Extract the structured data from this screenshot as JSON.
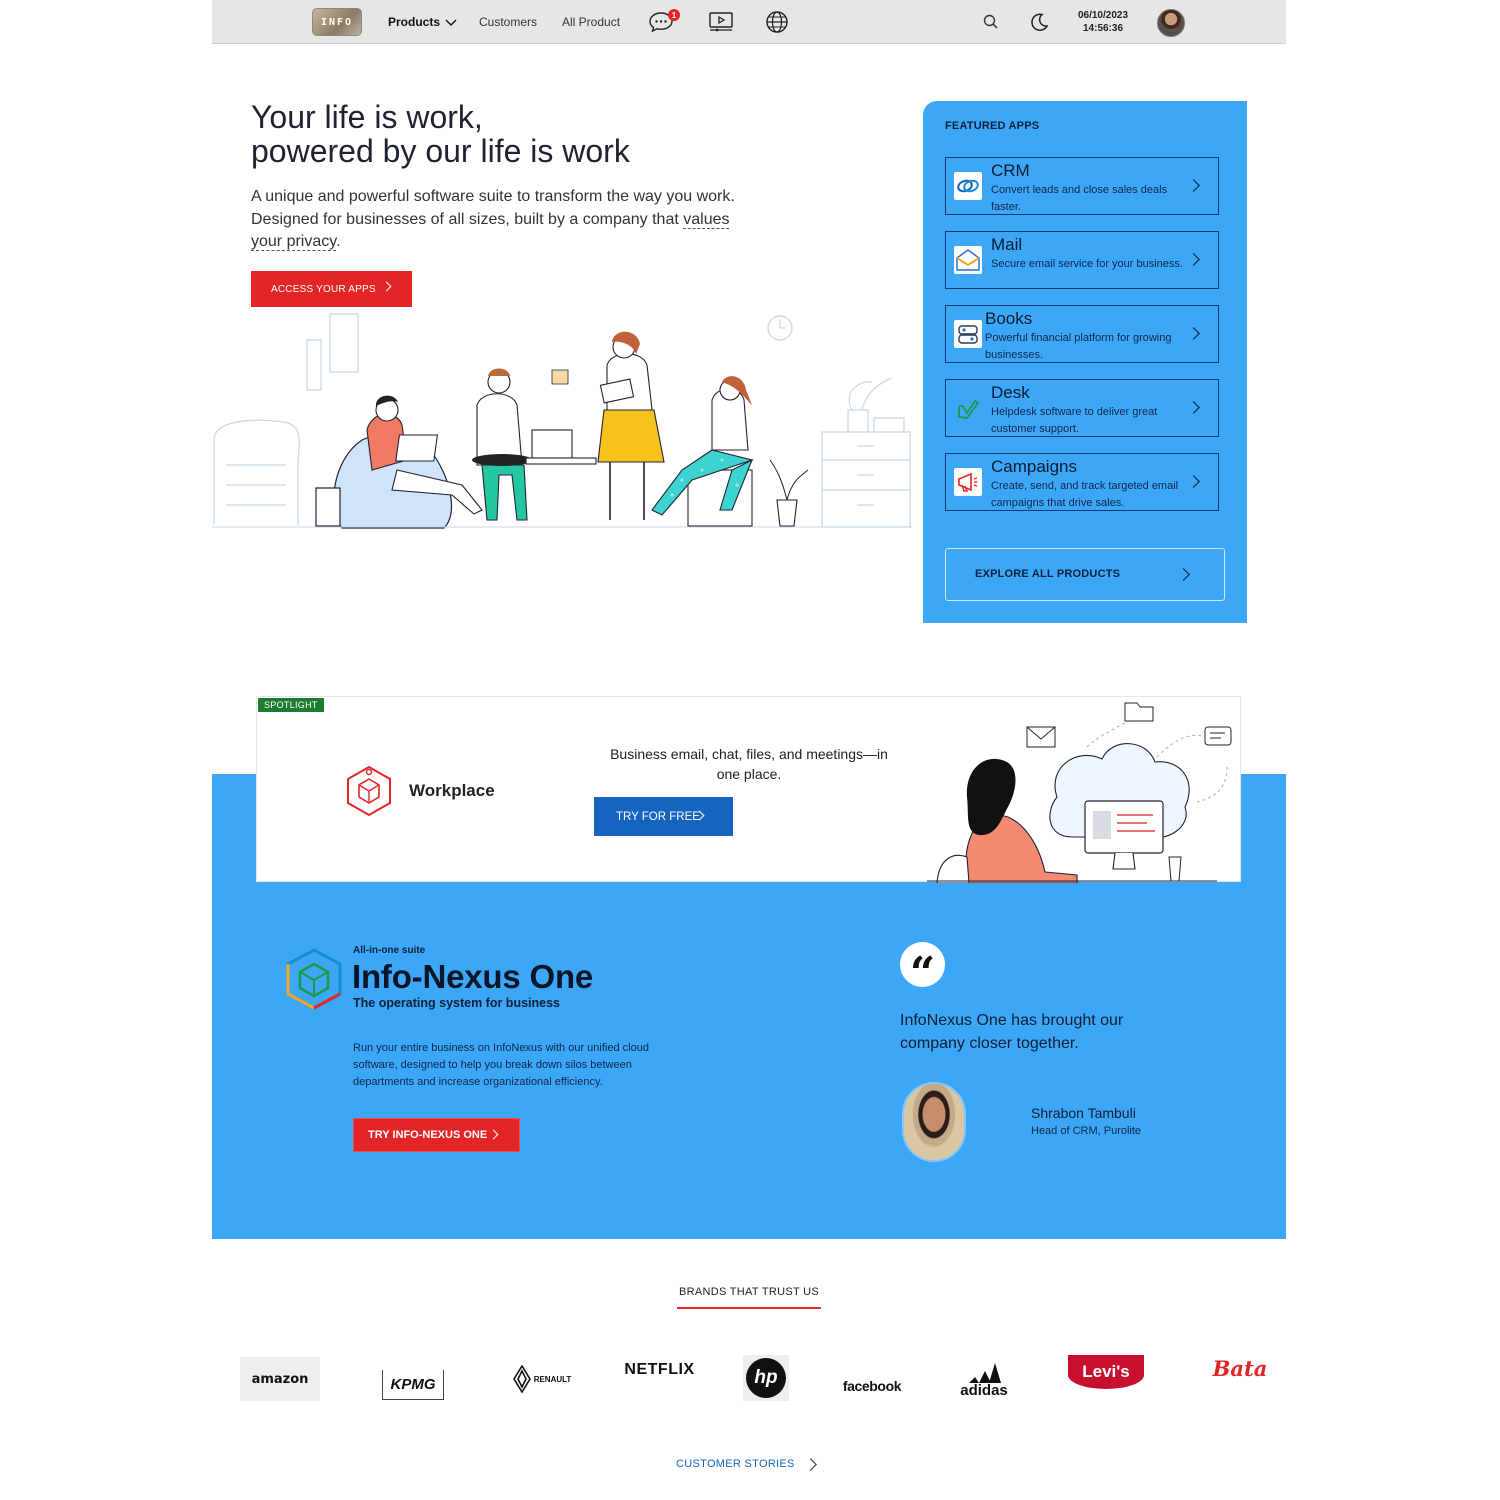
{
  "nav": {
    "logo_text": "INFO",
    "products": "Products",
    "customers": "Customers",
    "all_product": "All Product",
    "chat_badge": "1",
    "date": "06/10/2023",
    "time": "14:56:36"
  },
  "hero": {
    "title_line1": "Your life is work,",
    "title_line2": "powered by our life is work",
    "sub_part1": "A unique and powerful software suite to transform the way you work. Designed for businesses of all sizes, built by a company that ",
    "sub_link": "values your privacy",
    "sub_end": ".",
    "cta": "ACCESS YOUR APPS"
  },
  "featured": {
    "heading": "FEATURED APPS",
    "apps": [
      {
        "name": "CRM",
        "desc": "Convert leads and close sales deals faster.",
        "icon": "crm-icon"
      },
      {
        "name": "Mail",
        "desc": "Secure email service for your business.",
        "icon": "mail-icon"
      },
      {
        "name": "Books",
        "desc": "Powerful financial platform for growing businesses.",
        "icon": "books-icon"
      },
      {
        "name": "Desk",
        "desc": "Helpdesk software to deliver great customer support.",
        "icon": "desk-icon"
      },
      {
        "name": "Campaigns",
        "desc": "Create, send, and track targeted email campaigns that drive sales.",
        "icon": "campaigns-icon"
      }
    ],
    "explore": "EXPLORE ALL PRODUCTS"
  },
  "spotlight": {
    "tag": "SPOTLIGHT",
    "name": "Workplace",
    "desc": "Business email, chat, files, and meetings—in one place.",
    "cta": "TRY FOR FREE"
  },
  "suite": {
    "kicker": "All-in-one suite",
    "title": "Info-Nexus One",
    "tagline": "The operating system for business",
    "desc": "Run your entire business on InfoNexus with our unified cloud software, designed to help you break down silos between departments and increase organizational efficiency.",
    "cta": "TRY INFO-NEXUS ONE"
  },
  "testimonial": {
    "quote": "InfoNexus One has brought our company closer together.",
    "name": "Shrabon Tambuli",
    "role": "Head of CRM, Purolite"
  },
  "brands": {
    "heading": "BRANDS THAT TRUST US",
    "list": [
      "amazon",
      "KPMG",
      "RENAULT",
      "NETFLIX",
      "hp",
      "facebook",
      "adidas",
      "Levi's",
      "Bata"
    ],
    "stories": "CUSTOMER STORIES"
  },
  "colors": {
    "primary_blue": "#3ca7f7",
    "accent_red": "#e42527",
    "button_blue": "#1565c0",
    "spotlight_green": "#1c7c2f"
  }
}
